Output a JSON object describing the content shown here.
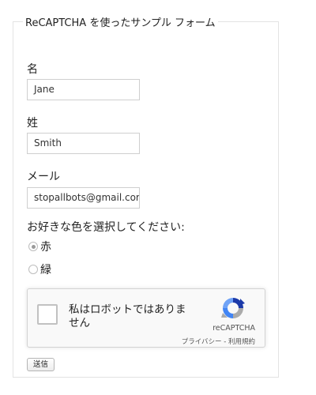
{
  "form": {
    "legend": "ReCAPTCHA を使ったサンプル フォーム",
    "first_name": {
      "label": "名",
      "value": "Jane"
    },
    "last_name": {
      "label": "姓",
      "value": "Smith"
    },
    "email": {
      "label": "メール",
      "value": "stopallbots@gmail.com"
    },
    "color_question": "お好きな色を選択してください:",
    "color_options": [
      {
        "label": "赤",
        "selected": true
      },
      {
        "label": "緑",
        "selected": false
      }
    ],
    "submit_label": "送信"
  },
  "recaptcha": {
    "checkbox_label": "私はロボットではありません",
    "brand": "reCAPTCHA",
    "links": "プライバシー - 利用規約",
    "checked": false
  },
  "colors": {
    "border": "#e3e3e3",
    "captcha_bg": "#f9f9f9",
    "logo_blue": "#1c3aa9",
    "logo_light_blue": "#4285f4",
    "logo_gray": "#ababab"
  },
  "icons": [
    "recaptcha-logo-icon"
  ]
}
